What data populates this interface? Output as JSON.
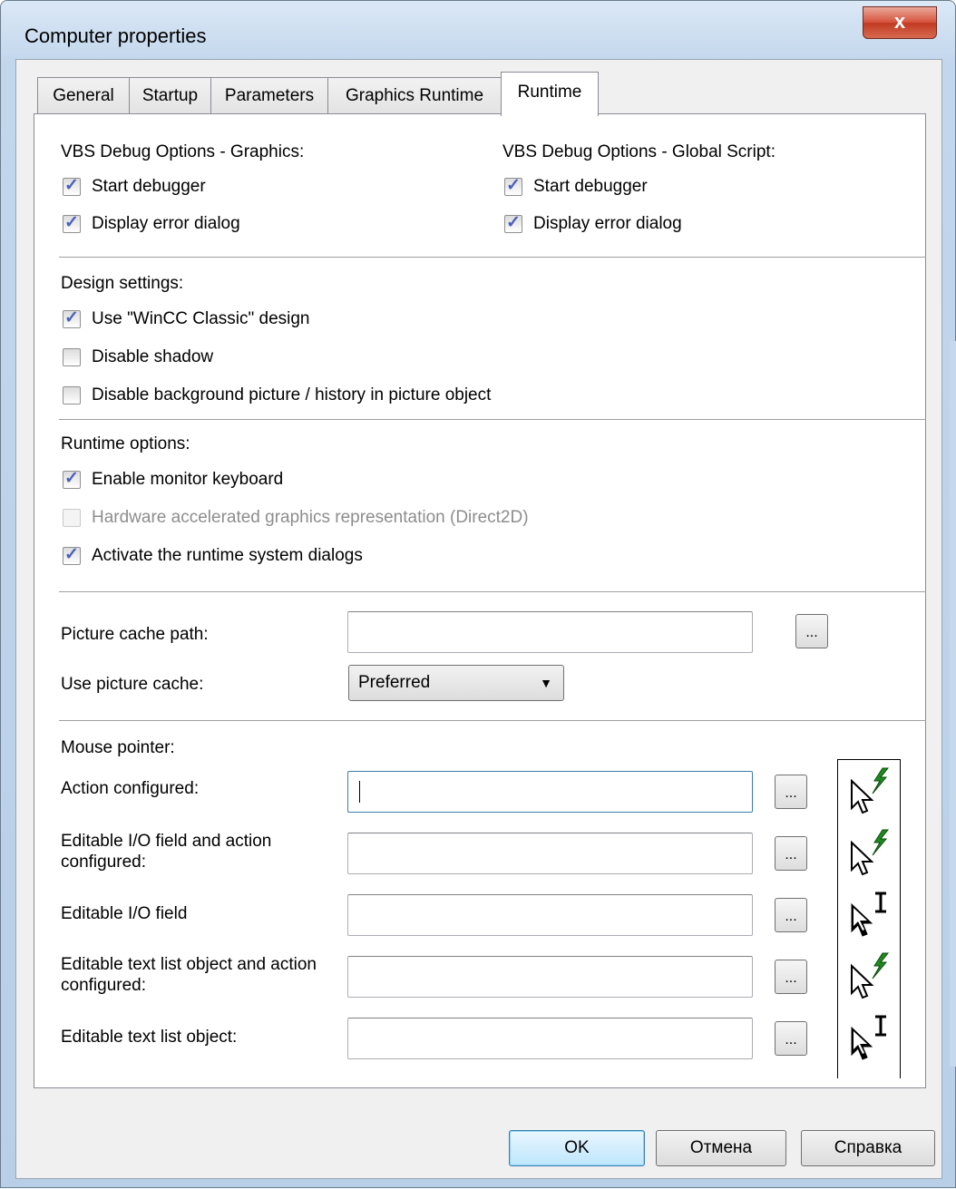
{
  "window": {
    "title": "Computer properties",
    "close_label": "x"
  },
  "tabs": [
    "General",
    "Startup",
    "Parameters",
    "Graphics Runtime",
    "Runtime"
  ],
  "active_tab": "Runtime",
  "vbs_graphics": {
    "heading": "VBS Debug Options - Graphics:",
    "start_debugger": {
      "label": "Start debugger",
      "checked": true
    },
    "display_error": {
      "label": "Display error dialog",
      "checked": true
    }
  },
  "vbs_global": {
    "heading": "VBS Debug Options - Global Script:",
    "start_debugger": {
      "label": "Start debugger",
      "checked": true
    },
    "display_error": {
      "label": "Display error dialog",
      "checked": true
    }
  },
  "design": {
    "heading": "Design settings:",
    "use_classic": {
      "label": "Use \"WinCC Classic\" design",
      "checked": true
    },
    "disable_shadow": {
      "label": "Disable shadow",
      "checked": false
    },
    "disable_background": {
      "label": "Disable background picture / history in picture object",
      "checked": false
    }
  },
  "runtime_options": {
    "heading": "Runtime options:",
    "monitor_keyboard": {
      "label": "Enable monitor keyboard",
      "checked": true
    },
    "hw_accel": {
      "label": "Hardware accelerated graphics representation (Direct2D)",
      "checked": false,
      "disabled": true
    },
    "system_dialogs": {
      "label": "Activate the runtime system dialogs",
      "checked": true
    }
  },
  "cache": {
    "path_label": "Picture cache path:",
    "path_value": "",
    "use_label": "Use picture cache:",
    "use_value": "Preferred",
    "browse_label": "..."
  },
  "mouse": {
    "heading": "Mouse pointer:",
    "browse_label": "...",
    "rows": [
      {
        "label": "Action configured:",
        "value": "",
        "icon": "arrow-lightning-cursor-icon"
      },
      {
        "label": "Editable I/O field and action configured:",
        "value": "",
        "icon": "arrow-lightning-cursor-icon"
      },
      {
        "label": "Editable I/O field",
        "value": "",
        "icon": "arrow-ibeam-cursor-icon"
      },
      {
        "label": "Editable text list object and action configured:",
        "value": "",
        "icon": "arrow-lightning-cursor-icon"
      },
      {
        "label": "Editable text list object:",
        "value": "",
        "icon": "arrow-ibeam-cursor-icon"
      }
    ]
  },
  "buttons": {
    "ok": "OK",
    "cancel": "Отмена",
    "help": "Справка"
  },
  "colors": {
    "check": "#4b5fbd",
    "lightning": "#1f8a1f",
    "title_bar": "#c2d6ec"
  }
}
